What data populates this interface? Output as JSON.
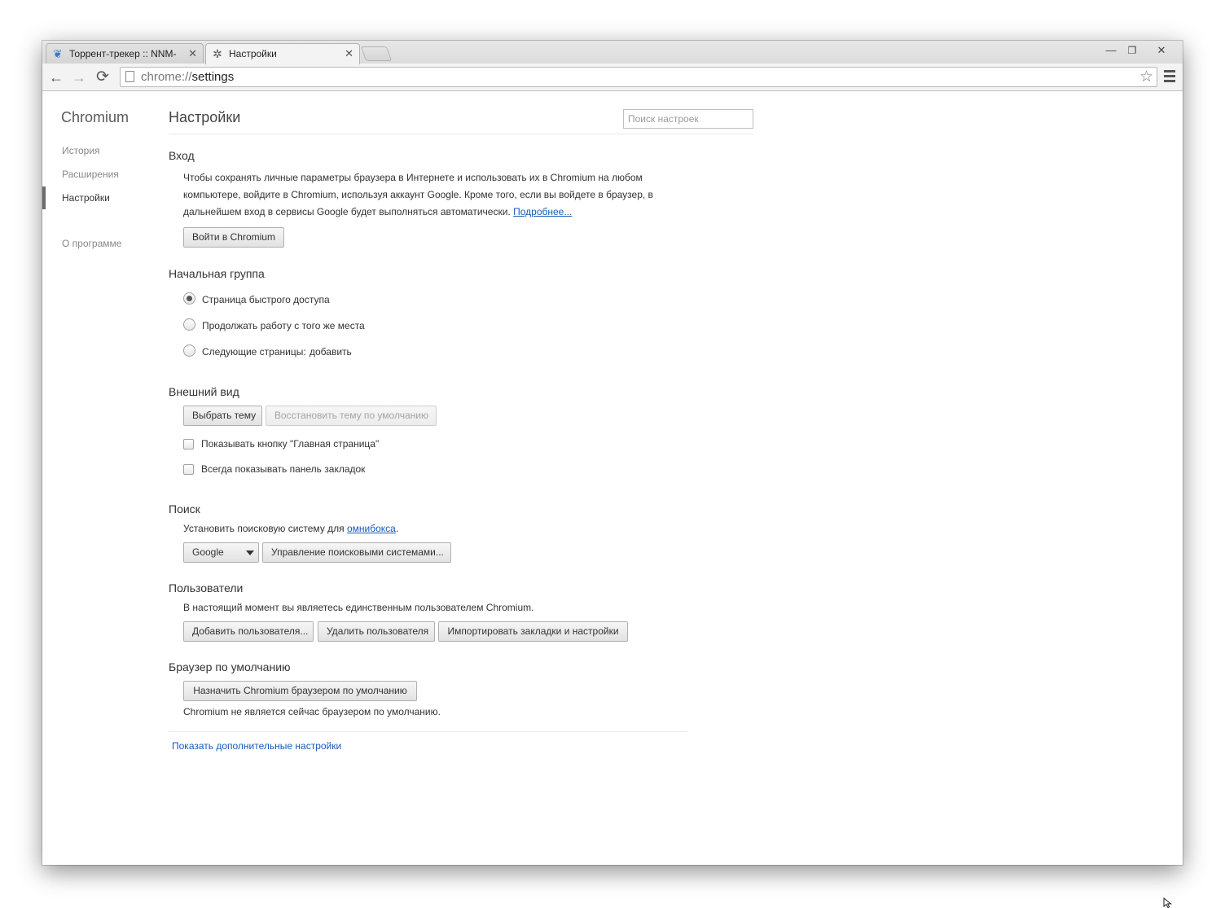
{
  "tabs": [
    {
      "title": "Торрент-трекер :: NNM-",
      "icon": "butterfly-icon",
      "close": "✕"
    },
    {
      "title": "Настройки",
      "icon": "gear-icon",
      "close": "✕"
    }
  ],
  "window_controls": {
    "minimize": "—",
    "maximize": "❐",
    "close": "✕"
  },
  "toolbar": {
    "back": "←",
    "forward": "→",
    "reload": "⟳",
    "url_scheme": "chrome://",
    "url_path": "settings",
    "bookmark_star": "☆"
  },
  "sidebar": {
    "title": "Chromium",
    "items": [
      {
        "label": "История"
      },
      {
        "label": "Расширения"
      },
      {
        "label": "Настройки",
        "active": true
      },
      {
        "label": "О программе"
      }
    ]
  },
  "header": {
    "title": "Настройки",
    "search_placeholder": "Поиск настроек"
  },
  "signin": {
    "title": "Вход",
    "lines": [
      "Чтобы сохранять личные параметры браузера в Интернете и использовать их в Chromium на любом",
      "компьютере, войдите в Chromium, используя аккаунт Google. Кроме того, если вы войдете в браузер, в",
      "дальнейшем вход в сервисы Google будет выполняться автоматически."
    ],
    "more_link": "Подробнее...",
    "button": "Войти в Chromium"
  },
  "startup": {
    "title": "Начальная группа",
    "options": [
      {
        "label": "Страница быстрого доступа",
        "checked": true
      },
      {
        "label": "Продолжать работу с того же места",
        "checked": false
      },
      {
        "label": "Следующие страницы:",
        "checked": false
      }
    ],
    "add_link": "добавить"
  },
  "appearance": {
    "title": "Внешний вид",
    "choose_theme": "Выбрать тему",
    "reset_theme": "Восстановить тему по умолчанию",
    "checkboxes": [
      {
        "label": "Показывать кнопку \"Главная страница\"",
        "checked": false
      },
      {
        "label": "Всегда показывать панель закладок",
        "checked": false
      }
    ]
  },
  "search": {
    "title": "Поиск",
    "text_before": "Установить поисковую систему для ",
    "omnibox_link": "омнибокса",
    "text_after": ".",
    "engine": "Google",
    "manage_button": "Управление поисковыми системами..."
  },
  "users": {
    "title": "Пользователи",
    "text": "В настоящий момент вы являетесь единственным пользователем Chromium.",
    "add_button": "Добавить пользователя...",
    "delete_button": "Удалить пользователя",
    "import_button": "Импортировать закладки и настройки"
  },
  "default_browser": {
    "title": "Браузер по умолчанию",
    "button": "Назначить Chromium браузером по умолчанию",
    "status": "Chromium не является сейчас браузером по умолчанию."
  },
  "advanced_link": "Показать дополнительные настройки"
}
